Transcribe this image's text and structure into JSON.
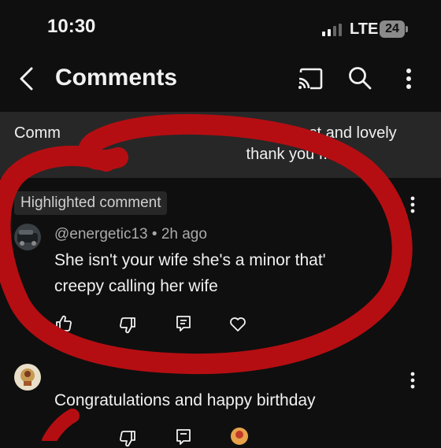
{
  "status_bar": {
    "time": "10:30",
    "network": "LTE",
    "battery": "24"
  },
  "header": {
    "title": "Comments"
  },
  "description_band": {
    "text": "Comm                                              my most and lovely\n                                                     thank you f..."
  },
  "comments": [
    {
      "badge": "Highlighted comment",
      "author": "@energetic13",
      "time": "2h ago",
      "text": "She isn't your wife she's a minor that'\ncreepy calling her wife"
    },
    {
      "text": "Congratulations and happy birthday"
    }
  ],
  "colors": {
    "background": "#0f0f0f",
    "band": "#272727",
    "scribble": "#b50e12",
    "secondary_text": "#aaaaaa"
  },
  "icons": [
    "back-icon",
    "cast-icon",
    "search-icon",
    "more-vert-icon",
    "like-icon",
    "dislike-icon",
    "reply-icon",
    "heart-icon"
  ]
}
